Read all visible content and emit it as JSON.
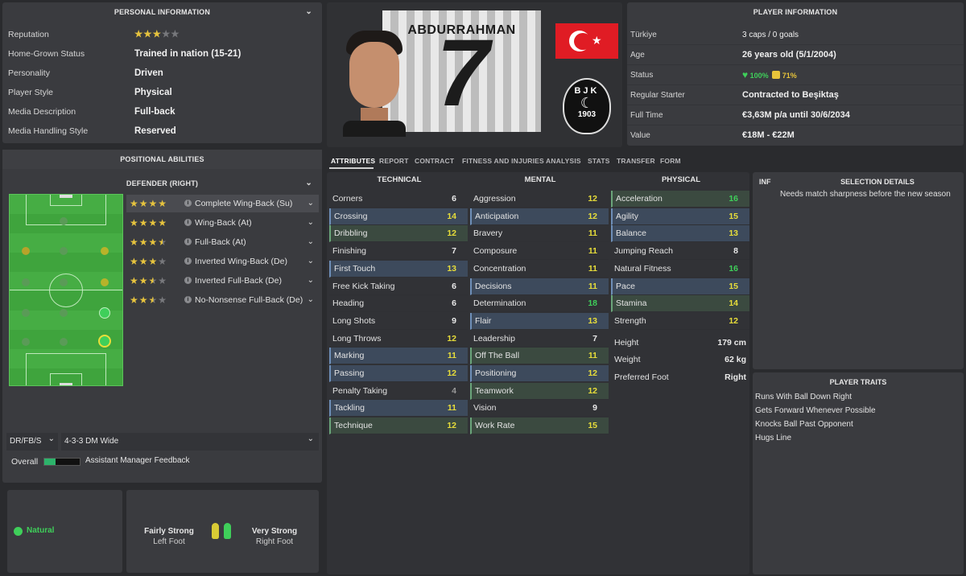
{
  "personal": {
    "title": "PERSONAL INFORMATION",
    "rows": [
      {
        "label": "Reputation",
        "value": ""
      },
      {
        "label": "Home-Grown Status",
        "value": "Trained in nation (15-21)"
      },
      {
        "label": "Personality",
        "value": "Driven"
      },
      {
        "label": "Player Style",
        "value": "Physical"
      },
      {
        "label": "Media Description",
        "value": "Full-back"
      },
      {
        "label": "Media Handling Style",
        "value": "Reserved"
      }
    ],
    "reputation_stars": 3
  },
  "positional": {
    "title": "POSITIONAL ABILITIES",
    "position": "DEFENDER (RIGHT)",
    "roles": [
      {
        "label": "Complete Wing-Back (Su)",
        "stars": 4
      },
      {
        "label": "Wing-Back (At)",
        "stars": 4
      },
      {
        "label": "Full-Back (At)",
        "stars": 3.5
      },
      {
        "label": "Inverted Wing-Back (De)",
        "stars": 3
      },
      {
        "label": "Inverted Full-Back (De)",
        "stars": 2.5
      },
      {
        "label": "No-Nonsense Full-Back (De)",
        "stars": 2.5
      }
    ],
    "role_select": "DR/FB/S",
    "tactic_select": "4-3-3 DM Wide",
    "overall_label": "Overall",
    "feedback_label": "Assistant Manager Feedback"
  },
  "bottom": {
    "natural_label": "Natural",
    "left_foot_strength": "Fairly Strong",
    "left_foot_label": "Left Foot",
    "right_foot_strength": "Very Strong",
    "right_foot_label": "Right Foot"
  },
  "header": {
    "name": "ABDURRAHMAN",
    "number": "7",
    "club_letters": "BJK",
    "club_year": "1903"
  },
  "player_info": {
    "title": "PLAYER INFORMATION",
    "rows": [
      {
        "label": "Türkiye",
        "value": "3 caps / 0 goals"
      },
      {
        "label": "Age",
        "value": "26 years old (5/1/2004)"
      },
      {
        "label": "Status",
        "value": ""
      },
      {
        "label": "Regular Starter",
        "value": "Contracted to Beşiktaş"
      },
      {
        "label": "Full Time",
        "value": "€3,63M p/a until 30/6/2034"
      },
      {
        "label": "Value",
        "value": "€18M - €22M"
      }
    ],
    "condition": "100%",
    "sharpness": "71%"
  },
  "tabs": [
    "ATTRIBUTES",
    "REPORT",
    "CONTRACT",
    "FITNESS AND INJURIES",
    "ANALYSIS",
    "STATS",
    "TRANSFER",
    "FORM"
  ],
  "attributes": {
    "technical_title": "TECHNICAL",
    "mental_title": "MENTAL",
    "physical_title": "PHYSICAL",
    "technical": [
      {
        "name": "Corners",
        "value": "6"
      },
      {
        "name": "Crossing",
        "value": "14"
      },
      {
        "name": "Dribbling",
        "value": "12"
      },
      {
        "name": "Finishing",
        "value": "7"
      },
      {
        "name": "First Touch",
        "value": "13"
      },
      {
        "name": "Free Kick Taking",
        "value": "6"
      },
      {
        "name": "Heading",
        "value": "6"
      },
      {
        "name": "Long Shots",
        "value": "9"
      },
      {
        "name": "Long Throws",
        "value": "12"
      },
      {
        "name": "Marking",
        "value": "11"
      },
      {
        "name": "Passing",
        "value": "12"
      },
      {
        "name": "Penalty Taking",
        "value": "4"
      },
      {
        "name": "Tackling",
        "value": "11"
      },
      {
        "name": "Technique",
        "value": "12"
      }
    ],
    "mental": [
      {
        "name": "Aggression",
        "value": "12"
      },
      {
        "name": "Anticipation",
        "value": "12"
      },
      {
        "name": "Bravery",
        "value": "11"
      },
      {
        "name": "Composure",
        "value": "11"
      },
      {
        "name": "Concentration",
        "value": "11"
      },
      {
        "name": "Decisions",
        "value": "11"
      },
      {
        "name": "Determination",
        "value": "18"
      },
      {
        "name": "Flair",
        "value": "13"
      },
      {
        "name": "Leadership",
        "value": "7"
      },
      {
        "name": "Off The Ball",
        "value": "11"
      },
      {
        "name": "Positioning",
        "value": "12"
      },
      {
        "name": "Teamwork",
        "value": "12"
      },
      {
        "name": "Vision",
        "value": "9"
      },
      {
        "name": "Work Rate",
        "value": "15"
      }
    ],
    "physical": [
      {
        "name": "Acceleration",
        "value": "16"
      },
      {
        "name": "Agility",
        "value": "15"
      },
      {
        "name": "Balance",
        "value": "13"
      },
      {
        "name": "Jumping Reach",
        "value": "8"
      },
      {
        "name": "Natural Fitness",
        "value": "16"
      },
      {
        "name": "Pace",
        "value": "15"
      },
      {
        "name": "Stamina",
        "value": "14"
      },
      {
        "name": "Strength",
        "value": "12"
      }
    ],
    "body": [
      {
        "name": "Height",
        "value": "179 cm"
      },
      {
        "name": "Weight",
        "value": "62 kg"
      },
      {
        "name": "Preferred Foot",
        "value": "Right"
      }
    ]
  },
  "selection": {
    "inf_label": "INF",
    "title": "SELECTION DETAILS",
    "text": "Needs match sharpness before the new season"
  },
  "traits": {
    "title": "PLAYER TRAITS",
    "items": [
      "Runs With Ball Down Right",
      "Gets Forward Whenever Possible",
      "Knocks Ball Past Opponent",
      "Hugs Line"
    ]
  },
  "colors": {
    "green": "#3fcf5a",
    "yellow": "#e8de3a",
    "accent_blue": "#3d4a5c"
  }
}
